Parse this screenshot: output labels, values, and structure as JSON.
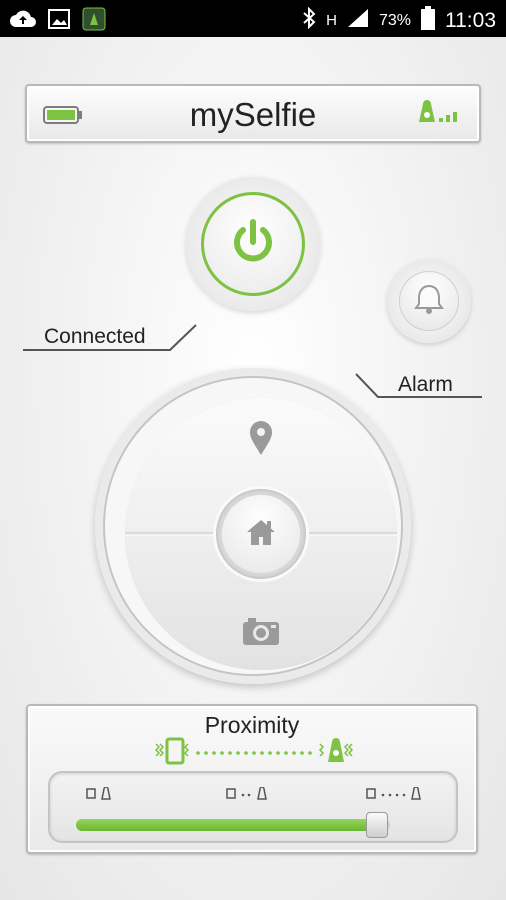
{
  "status_bar": {
    "battery_percent": "73%",
    "time": "11:03",
    "network_label": "H"
  },
  "app": {
    "title": "mySelfie"
  },
  "labels": {
    "connected": "Connected",
    "alarm": "Alarm"
  },
  "proximity": {
    "title": "Proximity",
    "level_fraction": 0.96
  },
  "colors": {
    "accent_green": "#7dc242",
    "icon_gray": "#8e8e8e"
  },
  "icons": {
    "titlebar_left": "battery-icon",
    "titlebar_right": "tag-signal-icon",
    "power": "power-icon",
    "alarm": "bell-icon",
    "dpad_top": "location-pin-icon",
    "dpad_center": "home-icon",
    "dpad_bottom": "camera-icon"
  }
}
